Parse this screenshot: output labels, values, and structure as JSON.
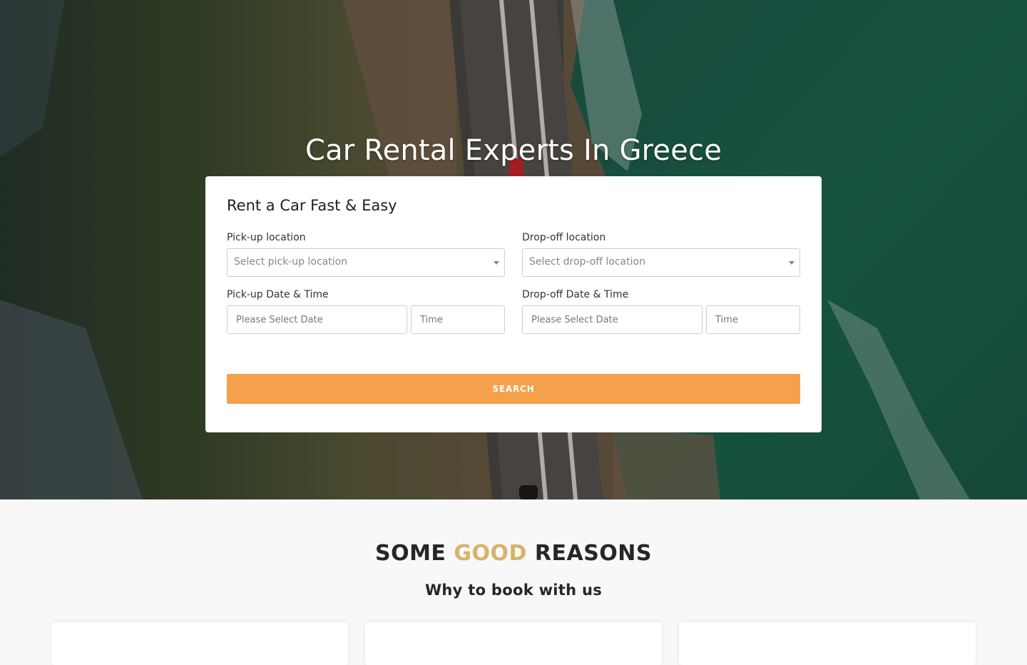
{
  "hero": {
    "title": "Car Rental Experts In Greece"
  },
  "booking": {
    "title": "Rent a Car Fast & Easy",
    "pickup_location_label": "Pick-up location",
    "pickup_location_placeholder": "Select pick-up location",
    "dropoff_location_label": "Drop-off location",
    "dropoff_location_placeholder": "Select drop-off location",
    "pickup_datetime_label": "Pick-up Date & Time",
    "pickup_date_placeholder": "Please Select Date",
    "pickup_time_placeholder": "Time",
    "dropoff_datetime_label": "Drop-off Date & Time",
    "dropoff_date_placeholder": "Please Select Date",
    "dropoff_time_placeholder": "Time",
    "search_label": "SEARCH"
  },
  "reasons": {
    "title_part1": "SOME",
    "title_accent": "GOOD",
    "title_part2": "REASONS",
    "subtitle": "Why to book with us"
  },
  "colors": {
    "accent_orange": "#f5a04a",
    "accent_gold": "#d7b36a"
  }
}
